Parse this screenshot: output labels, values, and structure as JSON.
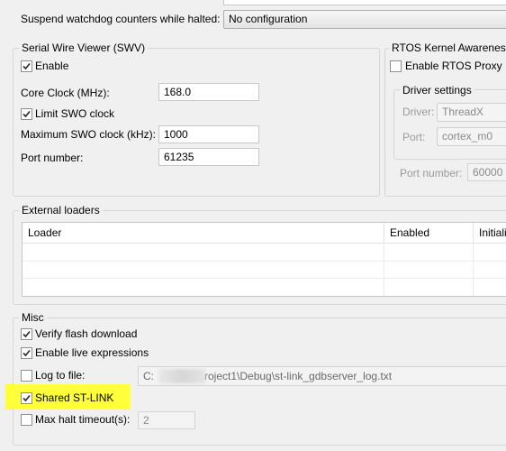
{
  "top": {
    "suspend_label": "Suspend watchdog counters while halted:",
    "suspend_value": "No configuration"
  },
  "swv": {
    "title": "Serial Wire Viewer (SWV)",
    "enable_label": "Enable",
    "enable_checked": true,
    "core_clock_label": "Core Clock (MHz):",
    "core_clock_value": "168.0",
    "limit_swo_label": "Limit SWO clock",
    "limit_swo_checked": true,
    "max_swo_label": "Maximum SWO clock (kHz):",
    "max_swo_value": "1000",
    "port_label": "Port number:",
    "port_value": "61235"
  },
  "rtos": {
    "title": "RTOS Kernel Awareness",
    "enable_label": "Enable RTOS Proxy",
    "enable_checked": false,
    "driver_settings_title": "Driver settings",
    "driver_label": "Driver:",
    "driver_value": "ThreadX",
    "port_label": "Port:",
    "port_value": "cortex_m0",
    "port_number_label": "Port number:",
    "port_number_value": "60000"
  },
  "external_loaders": {
    "title": "External loaders",
    "columns": [
      "Loader",
      "Enabled",
      "Initiali"
    ],
    "rows": [
      [
        "",
        "",
        ""
      ],
      [
        "",
        "",
        ""
      ],
      [
        "",
        "",
        ""
      ]
    ]
  },
  "misc": {
    "title": "Misc",
    "verify_flash_label": "Verify flash download",
    "verify_flash_checked": true,
    "live_expr_label": "Enable live expressions",
    "live_expr_checked": true,
    "log_label": "Log to file:",
    "log_checked": false,
    "log_path_prefix": "C:",
    "log_path_suffix": "roject1\\Debug\\st-link_gdbserver_log.txt",
    "shared_label": "Shared ST-LINK",
    "shared_checked": true,
    "max_halt_label": "Max halt timeout(s):",
    "max_halt_checked": false,
    "max_halt_value": "2"
  },
  "colors": {
    "highlight": "#ffff3a",
    "checkmark": "#2a2a2a"
  }
}
